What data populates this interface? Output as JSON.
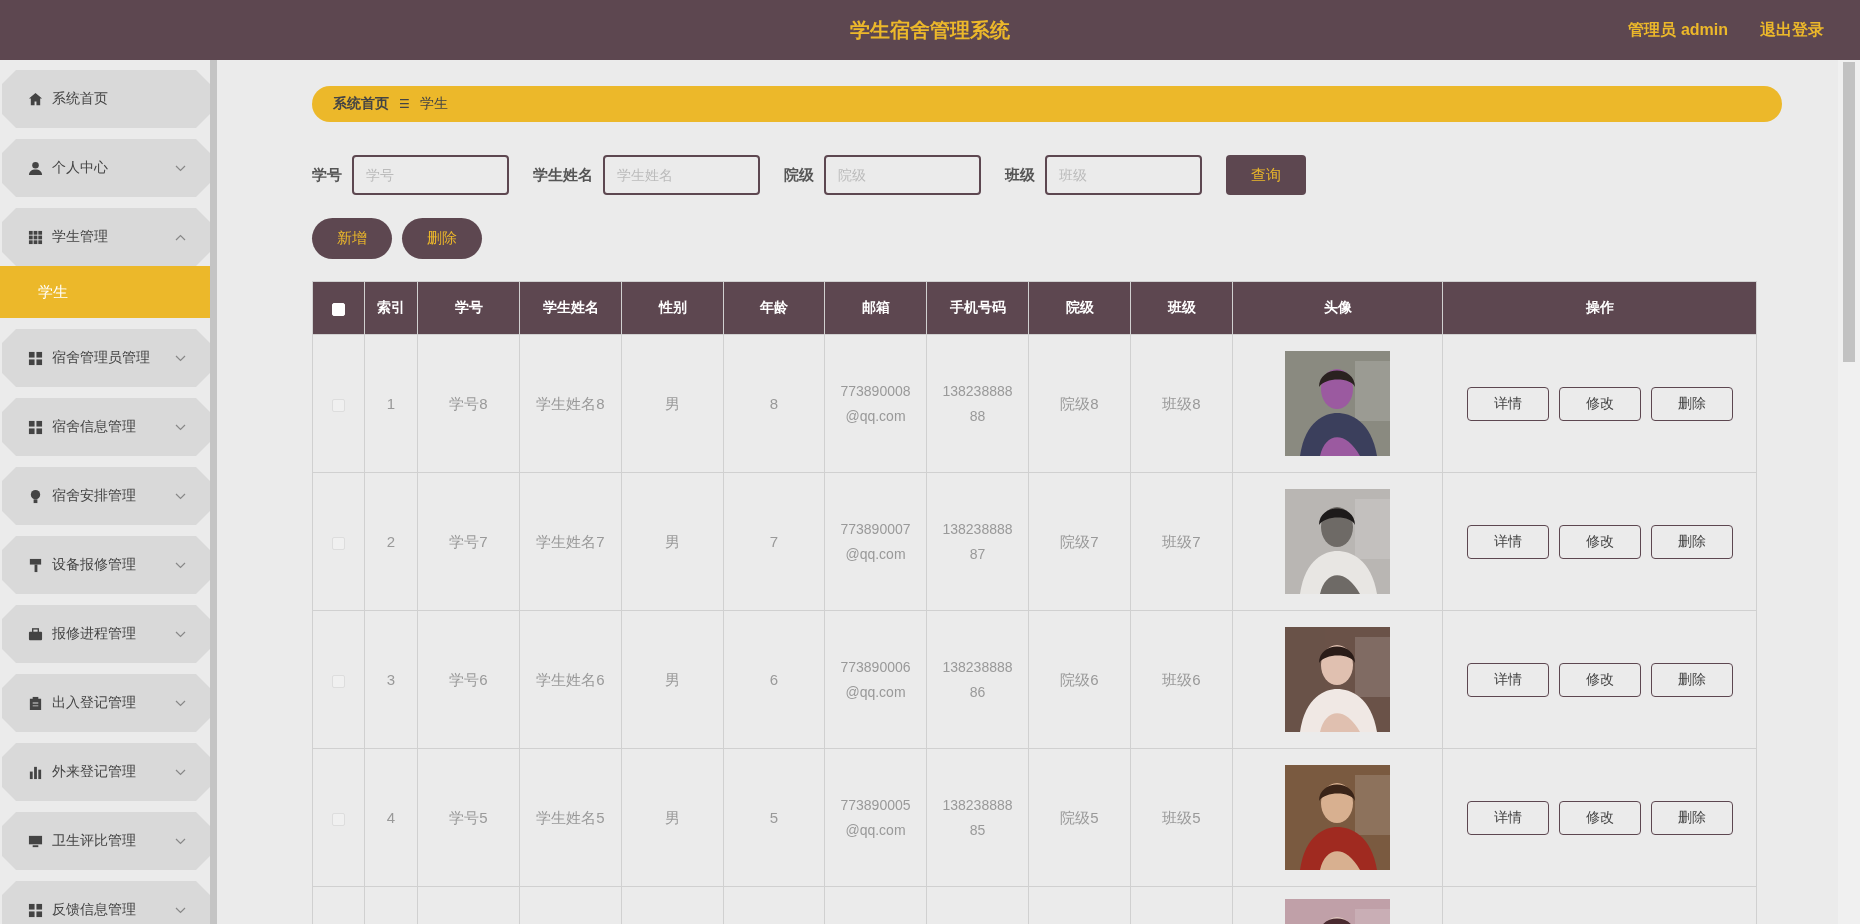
{
  "header": {
    "title": "学生宿舍管理系统",
    "user": "管理员 admin",
    "logout": "退出登录"
  },
  "sidebar": {
    "items": [
      {
        "label": "系统首页",
        "has_children": false
      },
      {
        "label": "个人中心",
        "has_children": true,
        "expanded": false
      },
      {
        "label": "学生管理",
        "has_children": true,
        "expanded": true,
        "children": [
          {
            "label": "学生",
            "selected": true
          }
        ]
      },
      {
        "label": "宿舍管理员管理",
        "has_children": true,
        "expanded": false
      },
      {
        "label": "宿舍信息管理",
        "has_children": true,
        "expanded": false
      },
      {
        "label": "宿舍安排管理",
        "has_children": true,
        "expanded": false
      },
      {
        "label": "设备报修管理",
        "has_children": true,
        "expanded": false
      },
      {
        "label": "报修进程管理",
        "has_children": true,
        "expanded": false
      },
      {
        "label": "出入登记管理",
        "has_children": true,
        "expanded": false
      },
      {
        "label": "外来登记管理",
        "has_children": true,
        "expanded": false
      },
      {
        "label": "卫生评比管理",
        "has_children": true,
        "expanded": false
      },
      {
        "label": "反馈信息管理",
        "has_children": true,
        "expanded": false
      }
    ]
  },
  "breadcrumb": {
    "home": "系统首页",
    "separator": "☰",
    "current": "学生"
  },
  "search": {
    "fields": [
      {
        "label": "学号",
        "placeholder": "学号"
      },
      {
        "label": "学生姓名",
        "placeholder": "学生姓名"
      },
      {
        "label": "院级",
        "placeholder": "院级"
      },
      {
        "label": "班级",
        "placeholder": "班级"
      }
    ],
    "button": "查询"
  },
  "actions": [
    "新增",
    "删除"
  ],
  "table": {
    "select_all": false,
    "columns": [
      "索引",
      "学号",
      "学生姓名",
      "性别",
      "年龄",
      "邮箱",
      "手机号码",
      "院级",
      "班级",
      "头像",
      "操作"
    ],
    "rows": [
      {
        "checked": false,
        "cells": [
          "1",
          "学号8",
          "学生姓名8",
          "男",
          "8",
          "773890008@qq.com",
          "13823888888",
          "院级8",
          "班级8"
        ],
        "avatar": {
          "kind": "picture"
        },
        "buttons": [
          "详情",
          "修改",
          "删除"
        ]
      },
      {
        "checked": false,
        "cells": [
          "2",
          "学号7",
          "学生姓名7",
          "男",
          "7",
          "773890007@qq.com",
          "13823888887",
          "院级7",
          "班级7"
        ],
        "avatar": {
          "kind": "picture"
        },
        "buttons": [
          "详情",
          "修改",
          "删除"
        ]
      },
      {
        "checked": false,
        "cells": [
          "3",
          "学号6",
          "学生姓名6",
          "男",
          "6",
          "773890006@qq.com",
          "13823888886",
          "院级6",
          "班级6"
        ],
        "avatar": {
          "kind": "picture"
        },
        "buttons": [
          "详情",
          "修改",
          "删除"
        ]
      },
      {
        "checked": false,
        "cells": [
          "4",
          "学号5",
          "学生姓名5",
          "男",
          "5",
          "773890005@qq.com",
          "13823888885",
          "院级5",
          "班级5"
        ],
        "avatar": {
          "kind": "picture"
        },
        "buttons": [
          "详情",
          "修改",
          "删除"
        ]
      }
    ],
    "partial_row": {
      "avatar": {
        "kind": "picture"
      }
    }
  }
}
